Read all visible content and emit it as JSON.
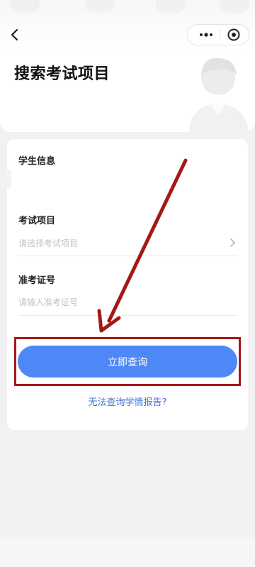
{
  "header": {
    "title": "搜索考试项目",
    "back_icon": "chevron-left-icon",
    "more_icon": "more-dots-icon",
    "close_icon": "target-circle-icon"
  },
  "form": {
    "student_info_label": "学生信息",
    "exam_item": {
      "label": "考试项目",
      "placeholder": "请选择考试项目",
      "value": ""
    },
    "admission_number": {
      "label": "准考证号",
      "placeholder": "请输入准考证号",
      "value": ""
    },
    "submit_label": "立即查询",
    "help_link": "无法查询学情报告?"
  },
  "colors": {
    "primary": "#4e88f7",
    "link": "#3e77d6",
    "annotation": "#a31818",
    "background": "#f1f1f3"
  }
}
